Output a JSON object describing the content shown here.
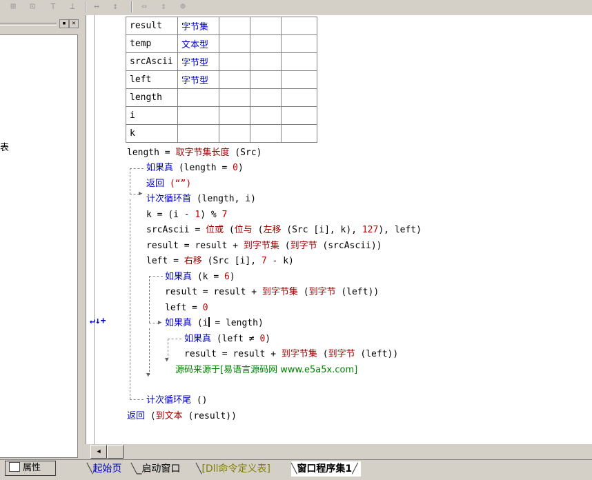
{
  "toolbar": {
    "icons": [
      "align-left-icon",
      "align-center-icon",
      "align-top-icon",
      "align-middle-icon",
      "same-width-icon",
      "same-height-icon",
      "equal-hspace-icon",
      "equal-vspace-icon",
      "center-icon"
    ]
  },
  "left_panel": {
    "clipped_text": "表"
  },
  "variables": [
    {
      "name": "result",
      "type": "字节集"
    },
    {
      "name": "temp",
      "type": "文本型"
    },
    {
      "name": "srcAscii",
      "type": "字节型"
    },
    {
      "name": "left",
      "type": "字节型"
    },
    {
      "name": "length",
      "type": ""
    },
    {
      "name": "i",
      "type": ""
    },
    {
      "name": "k",
      "type": ""
    }
  ],
  "code": {
    "l1": {
      "a": "length = ",
      "fn": "取字节集长度",
      "b": " (Src)"
    },
    "l2": {
      "kw": "如果真",
      "b": " (length = ",
      "n": "0",
      "c": ")"
    },
    "l3": {
      "kw": "返回",
      "b": " (“”)"
    },
    "l4": {
      "kw": "计次循环首",
      "b": " (length, i)"
    },
    "l5": {
      "a": "k = (i - ",
      "n1": "1",
      "b": ") % ",
      "n2": "7"
    },
    "l6": {
      "a": "srcAscii = ",
      "fn1": "位或",
      "b": " (",
      "fn2": "位与",
      "c": " (",
      "fn3": "左移",
      "d": " (Src [i], k), ",
      "n": "127",
      "e": "), left)"
    },
    "l7": {
      "a": "result = result + ",
      "fn1": "到字节集",
      "b": " (",
      "fn2": "到字节",
      "c": " (srcAscii))"
    },
    "l8": {
      "a": "left = ",
      "fn": "右移",
      "b": " (Src [i], ",
      "n": "7",
      "c": " - k)"
    },
    "l9": {
      "kw": "如果真",
      "b": " (k = ",
      "n": "6",
      "c": ")"
    },
    "l10": {
      "a": "result = result + ",
      "fn1": "到字节集",
      "b": " (",
      "fn2": "到字节",
      "c": " (left))"
    },
    "l11": {
      "a": "left = ",
      "n": "0"
    },
    "l12": {
      "kw": "如果真",
      "b": " (i",
      "c": " = length)"
    },
    "l13": {
      "kw": "如果真",
      "b": " (left ≠ ",
      "n": "0",
      "c": ")"
    },
    "l14": {
      "a": "result = result + ",
      "fn1": "到字节集",
      "b": " (",
      "fn2": "到字节",
      "c": " (left))"
    },
    "l15": {
      "cmt": "源码来源于[易语言源码网 www.e5a5x.com]"
    },
    "l16": {
      "kw": "计次循环尾",
      "b": " ()"
    },
    "l17": {
      "kw": "返回",
      "b": " (",
      "fn": "到文本",
      "c": " (result))"
    }
  },
  "gutter": {
    "marker": "↵↓+"
  },
  "bottom_tabs": {
    "properties": "属性",
    "tabs": [
      {
        "label": "起始页",
        "color": "#0000c8"
      },
      {
        "label": "_启动窗口",
        "color": "#000000"
      },
      {
        "label": "[Dll命令定义表]",
        "color": "#808000"
      },
      {
        "label": "窗口程序集1",
        "color": "#000000",
        "active": true
      }
    ]
  },
  "colors": {
    "keyword": "#0000c8",
    "function": "#a00000",
    "number": "#c00000",
    "comment": "#008000",
    "background": "#d4d0c8"
  }
}
